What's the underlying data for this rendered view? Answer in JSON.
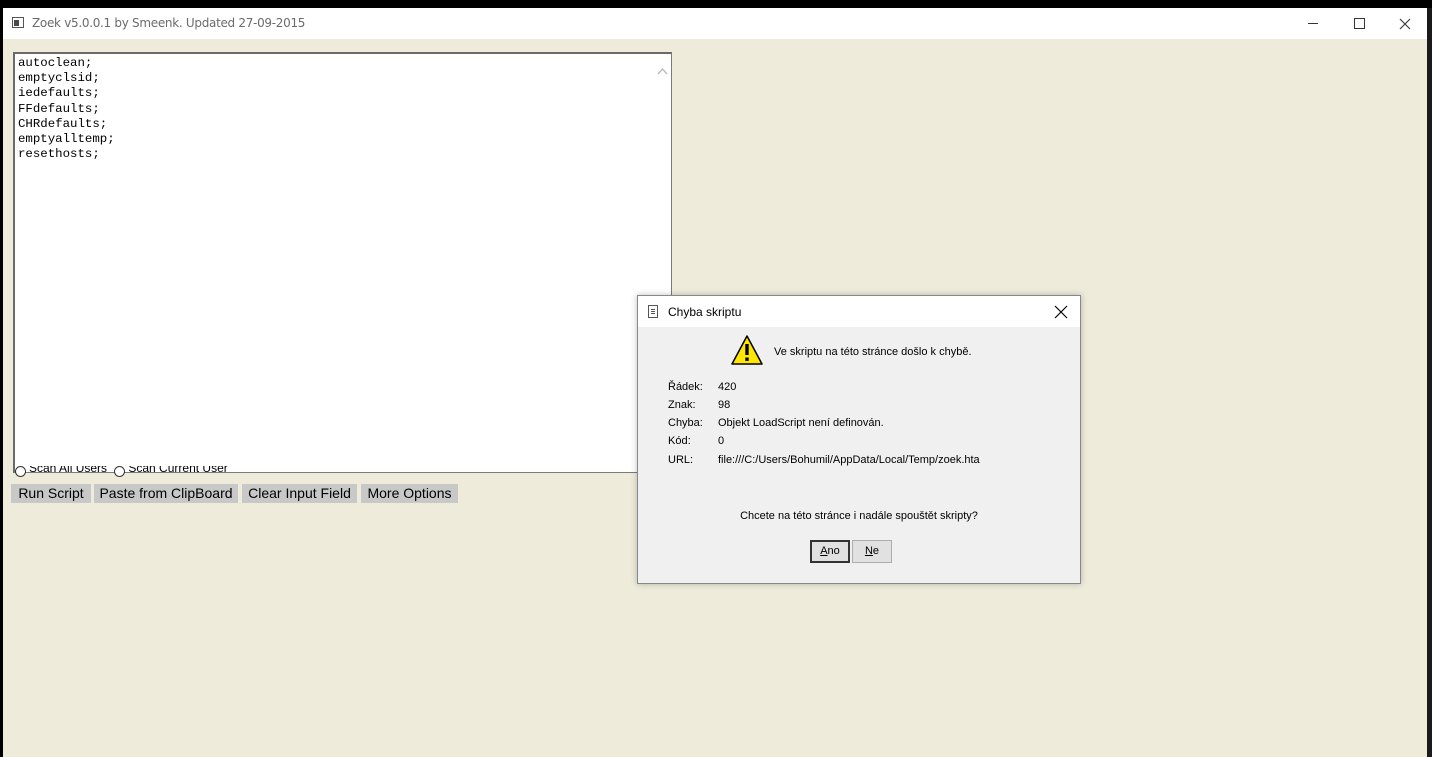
{
  "window": {
    "title": "Zoek v5.0.0.1 by Smeenk. Updated 27-09-2015"
  },
  "script_input": {
    "lines": "autoclean;\nemptyclsid;\niedefaults;\nFFdefaults;\nCHRdefaults;\nemptyalltemp;\nresethosts;"
  },
  "radio_options": {
    "scan_all_users": "Scan All Users",
    "scan_current_user": "Scan Current User"
  },
  "buttons": {
    "run_script": "Run Script",
    "paste_clipboard": "Paste from ClipBoard",
    "clear_input": "Clear Input Field",
    "more_options": "More Options"
  },
  "dialog": {
    "title": "Chyba skriptu",
    "message": "Ve skriptu na této stránce došlo k chybě.",
    "fields": [
      {
        "label": "Řádek:",
        "value": "420"
      },
      {
        "label": "Znak:",
        "value": "98"
      },
      {
        "label": "Chyba:",
        "value": "Objekt LoadScript není definován."
      },
      {
        "label": "Kód:",
        "value": "0"
      },
      {
        "label": "URL:",
        "value": "file:///C:/Users/Bohumil/AppData/Local/Temp/zoek.hta"
      }
    ],
    "question": "Chcete na této stránce i nadále spouštět skripty?",
    "yes_button_underline": "A",
    "yes_button_rest": "no",
    "no_button_underline": "N",
    "no_button_rest": "e"
  },
  "icons": {
    "app": "app-window-icon",
    "warning": "warning-icon",
    "document": "document-icon"
  },
  "colors": {
    "window_bg": "#efebdb",
    "button_bg": "#c8c8c8",
    "dialog_bg": "#f0f0f0",
    "warning_yellow": "#ffe600"
  }
}
